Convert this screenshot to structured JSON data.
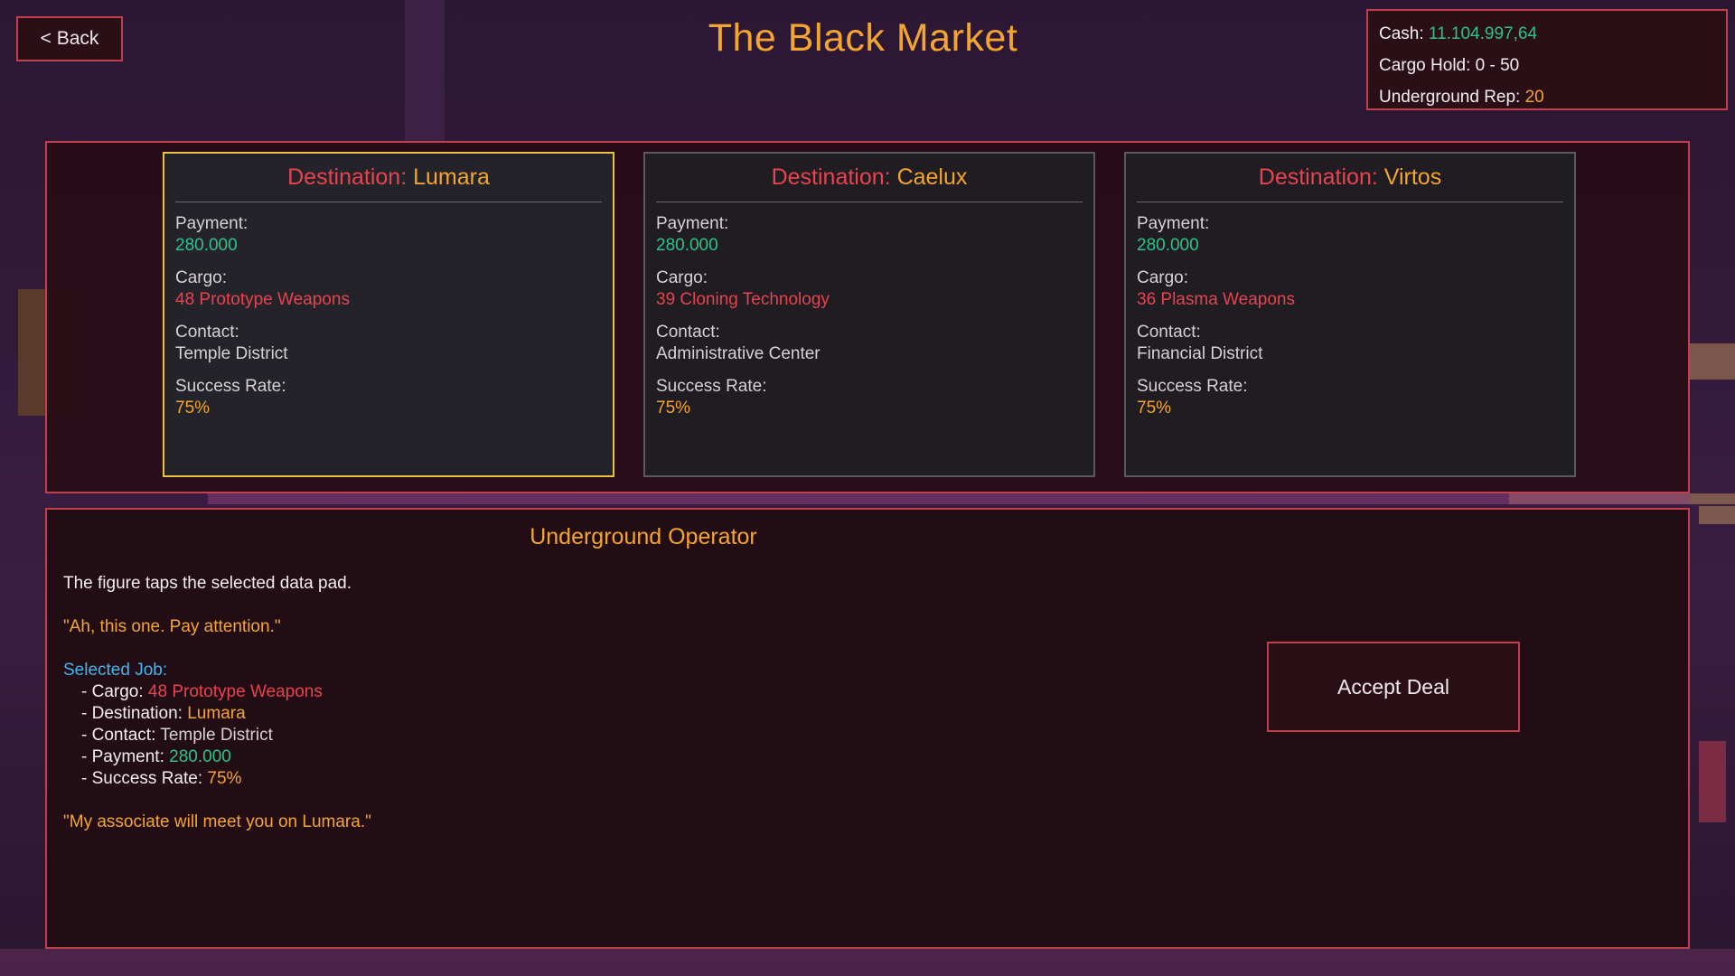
{
  "header": {
    "back_label": "< Back",
    "title": "The Black Market"
  },
  "stats": {
    "cash_label": "Cash: ",
    "cash_value": "11.104.997,64",
    "cargo_label": "Cargo Hold: 0 - 50",
    "rep_label": "Underground Rep: ",
    "rep_value": "20"
  },
  "jobs": [
    {
      "dest_label": "Destination: ",
      "dest_value": "Lumara",
      "payment_label": "Payment:",
      "payment_value": "280.000",
      "cargo_label": "Cargo:",
      "cargo_value": "48 Prototype Weapons",
      "contact_label": "Contact:",
      "contact_value": "Temple District",
      "success_label": "Success Rate:",
      "success_value": "75%",
      "selected": true
    },
    {
      "dest_label": "Destination: ",
      "dest_value": "Caelux",
      "payment_label": "Payment:",
      "payment_value": "280.000",
      "cargo_label": "Cargo:",
      "cargo_value": "39 Cloning Technology",
      "contact_label": "Contact:",
      "contact_value": "Administrative Center",
      "success_label": "Success Rate:",
      "success_value": "75%",
      "selected": false
    },
    {
      "dest_label": "Destination: ",
      "dest_value": "Virtos",
      "payment_label": "Payment:",
      "payment_value": "280.000",
      "cargo_label": "Cargo:",
      "cargo_value": "36 Plasma Weapons",
      "contact_label": "Contact:",
      "contact_value": "Financial District",
      "success_label": "Success Rate:",
      "success_value": "75%",
      "selected": false
    }
  ],
  "dialog": {
    "title": "Underground Operator",
    "narration": "The figure taps the selected data pad.",
    "quote1": "\"Ah, this one. Pay attention.\"",
    "selected_heading": "Selected Job:",
    "cargo_label": "- Cargo: ",
    "cargo_value": "48 Prototype Weapons",
    "dest_label": "- Destination: ",
    "dest_value": "Lumara",
    "contact_label": "- Contact: ",
    "contact_value": "Temple District",
    "payment_label": "- Payment: ",
    "payment_value": "280.000",
    "success_label": "- Success Rate: ",
    "success_value": "75%",
    "quote2": "\"My associate will meet you on Lumara.\"",
    "accept_label": "Accept Deal"
  },
  "colors": {
    "accent_orange": "#f4a531",
    "money_green": "#2cc38a",
    "cargo_red": "#e8434f",
    "heading_blue": "#3fb6ef",
    "panel_border": "#c2404e",
    "selected_border": "#e8c23e"
  }
}
